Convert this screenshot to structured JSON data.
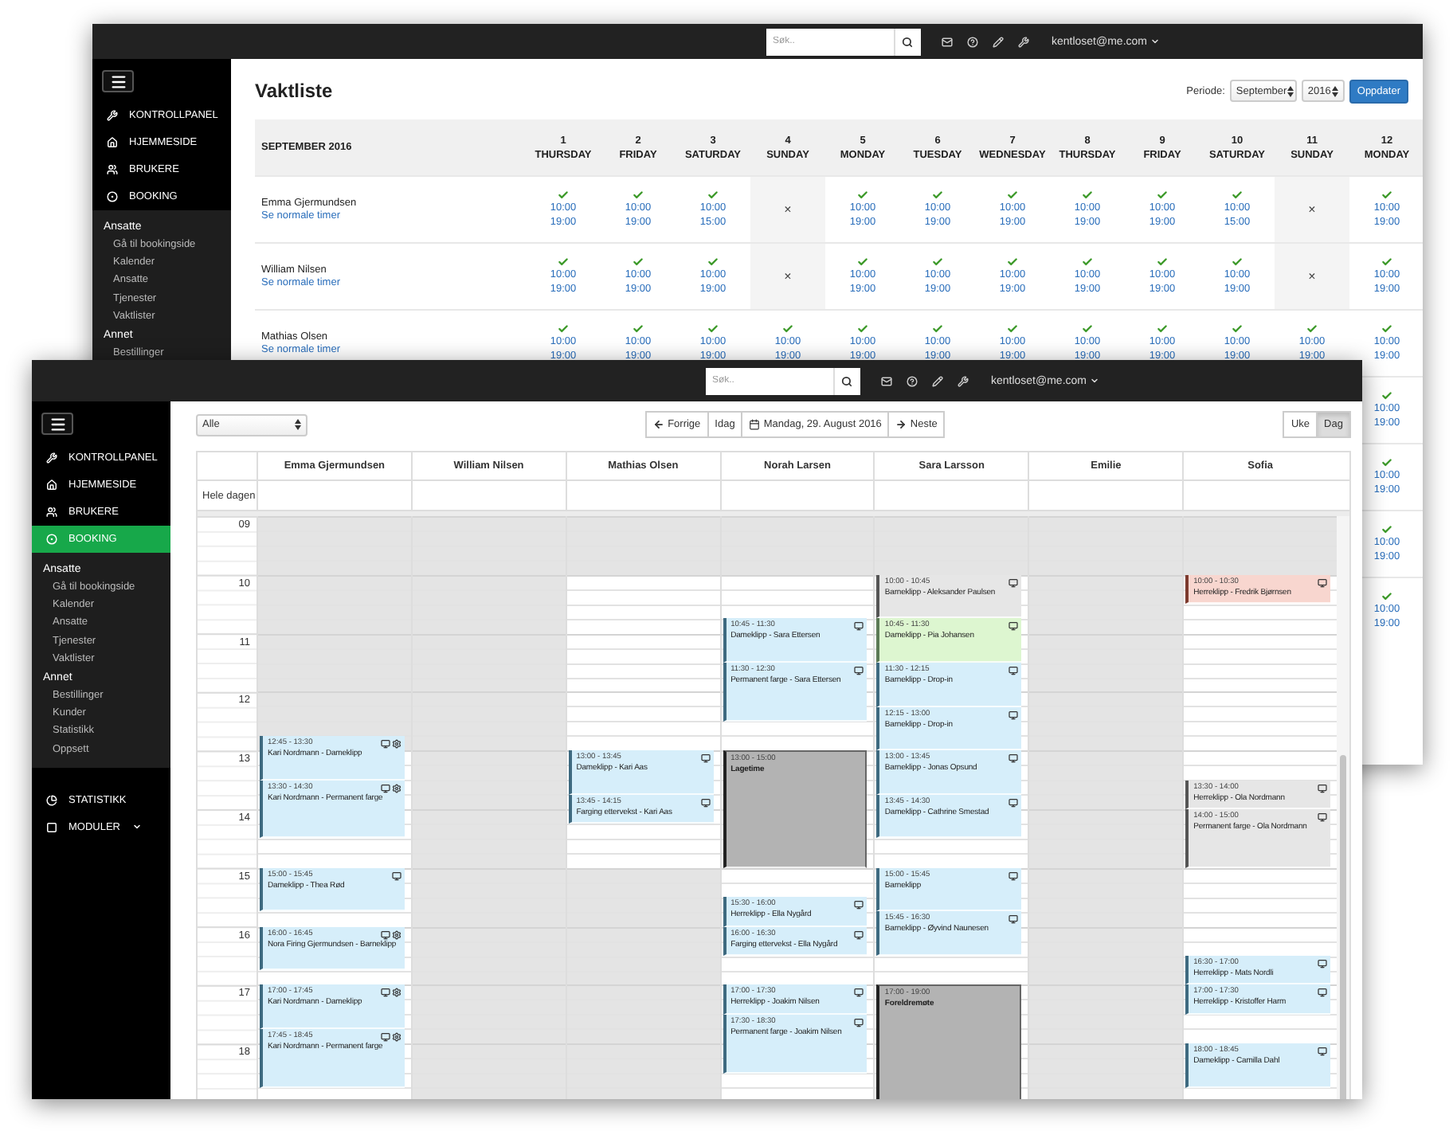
{
  "back_window": {
    "topbar": {
      "search": {
        "placeholder": "Søk.."
      },
      "user": "kentloset@me.com"
    },
    "sidebar": {
      "main_items": [
        {
          "label": "KONTROLLPANEL",
          "selected": false
        },
        {
          "label": "HJEMMESIDE",
          "selected": false
        },
        {
          "label": "BRUKERE",
          "selected": false
        },
        {
          "label": "BOOKING",
          "selected": false
        }
      ],
      "sections": [
        {
          "title": "Ansatte",
          "items": [
            "Gå til bookingside",
            "Kalender",
            "Ansatte",
            "Tjenester",
            "Vaktlister"
          ]
        },
        {
          "title": "Annet",
          "items": [
            "Bestillinger"
          ]
        }
      ]
    },
    "title": "Vaktliste",
    "period": {
      "label": "Periode:",
      "month": "September",
      "year": "2016",
      "button": "Oppdater"
    },
    "table": {
      "heading": "SEPTEMBER 2016",
      "days": [
        {
          "date": "1",
          "weekday": "THURSDAY"
        },
        {
          "date": "2",
          "weekday": "FRIDAY"
        },
        {
          "date": "3",
          "weekday": "SATURDAY"
        },
        {
          "date": "4",
          "weekday": "SUNDAY"
        },
        {
          "date": "5",
          "weekday": "MONDAY"
        },
        {
          "date": "6",
          "weekday": "TUESDAY"
        },
        {
          "date": "7",
          "weekday": "WEDNESDAY"
        },
        {
          "date": "8",
          "weekday": "THURSDAY"
        },
        {
          "date": "9",
          "weekday": "FRIDAY"
        },
        {
          "date": "10",
          "weekday": "SATURDAY"
        },
        {
          "date": "11",
          "weekday": "SUNDAY"
        },
        {
          "date": "12",
          "weekday": "MONDAY"
        }
      ],
      "rows": [
        {
          "name": "Emma Gjermundsen",
          "link": "Se normale timer",
          "cells": [
            {
              "kind": "shift",
              "start": "10:00",
              "end": "19:00"
            },
            {
              "kind": "shift",
              "start": "10:00",
              "end": "19:00"
            },
            {
              "kind": "shift",
              "start": "10:00",
              "end": "15:00"
            },
            {
              "kind": "off",
              "mark": "×"
            },
            {
              "kind": "shift",
              "start": "10:00",
              "end": "19:00"
            },
            {
              "kind": "shift",
              "start": "10:00",
              "end": "19:00"
            },
            {
              "kind": "shift",
              "start": "10:00",
              "end": "19:00"
            },
            {
              "kind": "shift",
              "start": "10:00",
              "end": "19:00"
            },
            {
              "kind": "shift",
              "start": "10:00",
              "end": "19:00"
            },
            {
              "kind": "shift",
              "start": "10:00",
              "end": "15:00"
            },
            {
              "kind": "off",
              "mark": "×"
            },
            {
              "kind": "shift",
              "start": "10:00",
              "end": "19:00"
            }
          ]
        },
        {
          "name": "William Nilsen",
          "link": "Se normale timer",
          "cells": [
            {
              "kind": "shift",
              "start": "10:00",
              "end": "19:00"
            },
            {
              "kind": "shift",
              "start": "10:00",
              "end": "19:00"
            },
            {
              "kind": "shift",
              "start": "10:00",
              "end": "19:00"
            },
            {
              "kind": "off",
              "mark": "×"
            },
            {
              "kind": "shift",
              "start": "10:00",
              "end": "19:00"
            },
            {
              "kind": "shift",
              "start": "10:00",
              "end": "19:00"
            },
            {
              "kind": "shift",
              "start": "10:00",
              "end": "19:00"
            },
            {
              "kind": "shift",
              "start": "10:00",
              "end": "19:00"
            },
            {
              "kind": "shift",
              "start": "10:00",
              "end": "19:00"
            },
            {
              "kind": "shift",
              "start": "10:00",
              "end": "19:00"
            },
            {
              "kind": "off",
              "mark": "×"
            },
            {
              "kind": "shift",
              "start": "10:00",
              "end": "19:00"
            }
          ]
        },
        {
          "name": "Mathias Olsen",
          "link": "Se normale timer",
          "cells": [
            {
              "kind": "shift",
              "start": "10:00",
              "end": "19:00"
            },
            {
              "kind": "shift",
              "start": "10:00",
              "end": "19:00"
            },
            {
              "kind": "shift",
              "start": "10:00",
              "end": "19:00"
            },
            {
              "kind": "shift",
              "start": "10:00",
              "end": "19:00"
            },
            {
              "kind": "shift",
              "start": "10:00",
              "end": "19:00"
            },
            {
              "kind": "shift",
              "start": "10:00",
              "end": "19:00"
            },
            {
              "kind": "shift",
              "start": "10:00",
              "end": "19:00"
            },
            {
              "kind": "shift",
              "start": "10:00",
              "end": "19:00"
            },
            {
              "kind": "shift",
              "start": "10:00",
              "end": "19:00"
            },
            {
              "kind": "shift",
              "start": "10:00",
              "end": "19:00"
            },
            {
              "kind": "shift",
              "start": "10:00",
              "end": "19:00"
            },
            {
              "kind": "shift",
              "start": "10:00",
              "end": "19:00"
            }
          ]
        }
      ],
      "more_rows": [
        {
          "last_cell": {
            "kind": "shift",
            "start": "10:00",
            "end": "19:00"
          }
        },
        {
          "last_cell": {
            "kind": "shift",
            "start": "10:00",
            "end": "19:00"
          }
        },
        {
          "last_cell": {
            "kind": "shift",
            "start": "10:00",
            "end": "19:00"
          }
        },
        {
          "last_cell": {
            "kind": "shift",
            "start": "10:00",
            "end": "19:00"
          }
        }
      ]
    }
  },
  "front_window": {
    "topbar": {
      "search": {
        "placeholder": "Søk.."
      },
      "user": "kentloset@me.com"
    },
    "sidebar": {
      "main_items": [
        {
          "label": "KONTROLLPANEL",
          "selected": false
        },
        {
          "label": "HJEMMESIDE",
          "selected": false
        },
        {
          "label": "BRUKERE",
          "selected": false
        },
        {
          "label": "BOOKING",
          "selected": true
        }
      ],
      "sections": [
        {
          "title": "Ansatte",
          "items": [
            "Gå til bookingside",
            "Kalender",
            "Ansatte",
            "Tjenester",
            "Vaktlister"
          ]
        },
        {
          "title": "Annet",
          "items": [
            "Bestillinger",
            "Kunder",
            "Statistikk",
            "Oppsett"
          ]
        }
      ],
      "bottom_items": [
        {
          "label": "STATISTIKK",
          "dropdown": false
        },
        {
          "label": "MODULER",
          "dropdown": true
        }
      ]
    },
    "filter": {
      "value": "Alle"
    },
    "nav": {
      "previous": "Forrige",
      "today": "Idag",
      "date": "Mandag, 29. August 2016",
      "next": "Neste"
    },
    "views": [
      {
        "label": "Uke",
        "selected": false
      },
      {
        "label": "Dag",
        "selected": true
      }
    ],
    "calendar": {
      "all_day_label": "Hele dagen",
      "hours": [
        "09",
        "10",
        "11",
        "12",
        "13",
        "14",
        "15",
        "16",
        "17",
        "18"
      ],
      "resources": [
        {
          "name": "Emma Gjermundsen",
          "open": [
            false,
            false,
            false,
            false,
            true,
            true,
            true,
            true,
            true,
            true
          ],
          "events": [
            {
              "time": "12:45 - 13:30",
              "title": "Kari Nordmann - Dameklipp",
              "kind": "booked",
              "screen": true,
              "gear": true
            },
            {
              "time": "13:30 - 14:30",
              "title": "Kari Nordmann - Permanent farge",
              "kind": "booked",
              "screen": true,
              "gear": true
            },
            {
              "time": "15:00 - 15:45",
              "title": "Dameklipp - Thea Rød",
              "kind": "booked",
              "screen": true,
              "gear": false
            },
            {
              "time": "16:00 - 16:45",
              "title": "Nora Firing Gjermundsen - Barneklipp",
              "kind": "booked",
              "screen": true,
              "gear": true
            },
            {
              "time": "17:00 - 17:45",
              "title": "Kari Nordmann - Dameklipp",
              "kind": "booked",
              "screen": true,
              "gear": true
            },
            {
              "time": "17:45 - 18:45",
              "title": "Kari Nordmann - Permanent farge",
              "kind": "booked",
              "screen": true,
              "gear": true
            }
          ]
        },
        {
          "name": "William Nilsen",
          "open": [
            false,
            false,
            false,
            false,
            false,
            false,
            false,
            false,
            false,
            false
          ]
        },
        {
          "name": "Mathias Olsen",
          "open": [
            false,
            true,
            true,
            true,
            true,
            true,
            false,
            false,
            false,
            false
          ],
          "events": [
            {
              "time": "13:00 - 13:45",
              "title": "Dameklipp - Kari Aas",
              "kind": "booked",
              "screen": true,
              "gear": false
            },
            {
              "time": "13:45 - 14:15",
              "title": "Farging ettervekst - Kari Aas",
              "kind": "booked",
              "screen": true,
              "gear": false
            }
          ]
        },
        {
          "name": "Norah Larsen",
          "open": [
            false,
            true,
            true,
            true,
            true,
            true,
            true,
            true,
            true,
            true
          ],
          "events": [
            {
              "time": "10:45 - 11:30",
              "title": "Dameklipp - Sara Ettersen",
              "kind": "booked",
              "screen": true,
              "gear": false
            },
            {
              "time": "11:30 - 12:30",
              "title": "Permanent farge - Sara Ettersen",
              "kind": "booked",
              "screen": true,
              "gear": false
            },
            {
              "time": "13:00 - 15:00",
              "title": "Lagetime",
              "kind": "block",
              "screen": false,
              "gear": false
            },
            {
              "time": "15:30 - 16:00",
              "title": "Herreklipp - Ella Nygård",
              "kind": "booked",
              "screen": true,
              "gear": false
            },
            {
              "time": "16:00 - 16:30",
              "title": "Farging ettervekst - Ella Nygård",
              "kind": "booked",
              "screen": true,
              "gear": false
            },
            {
              "time": "17:00 - 17:30",
              "title": "Herreklipp - Joakim Nilsen",
              "kind": "booked",
              "screen": true,
              "gear": false
            },
            {
              "time": "17:30 - 18:30",
              "title": "Permanent farge - Joakim Nilsen",
              "kind": "booked",
              "screen": true,
              "gear": false
            }
          ]
        },
        {
          "name": "Sara Larsson",
          "open": [
            false,
            true,
            true,
            true,
            true,
            true,
            true,
            true,
            true,
            true
          ],
          "events": [
            {
              "time": "10:00 - 10:45",
              "title": "Barneklipp - Aleksander Paulsen",
              "kind": "pending",
              "screen": true,
              "gear": false
            },
            {
              "time": "10:45 - 11:30",
              "title": "Dameklipp - Pia Johansen",
              "kind": "confirmed",
              "screen": true,
              "gear": false
            },
            {
              "time": "11:30 - 12:15",
              "title": "Barneklipp - Drop-in",
              "kind": "booked",
              "screen": true,
              "gear": false
            },
            {
              "time": "12:15 - 13:00",
              "title": "Barneklipp - Drop-in",
              "kind": "booked",
              "screen": true,
              "gear": false
            },
            {
              "time": "13:00 - 13:45",
              "title": "Barneklipp - Jonas Opsund",
              "kind": "booked",
              "screen": true,
              "gear": false
            },
            {
              "time": "13:45 - 14:30",
              "title": "Dameklipp - Cathrine Smestad",
              "kind": "booked",
              "screen": true,
              "gear": false
            },
            {
              "time": "15:00 - 15:45",
              "title": "Barneklipp",
              "kind": "booked",
              "screen": true,
              "gear": false
            },
            {
              "time": "15:45 - 16:30",
              "title": "Barneklipp - Øyvind Naunesen",
              "kind": "booked",
              "screen": true,
              "gear": false
            },
            {
              "time": "17:00 - 19:00",
              "title": "Foreldremøte",
              "kind": "block",
              "screen": false,
              "gear": false
            }
          ]
        },
        {
          "name": "Emilie",
          "open": [
            false,
            false,
            false,
            false,
            false,
            false,
            false,
            false,
            false,
            false
          ]
        },
        {
          "name": "Sofia",
          "open": [
            false,
            true,
            true,
            true,
            true,
            true,
            true,
            true,
            true,
            true
          ],
          "events": [
            {
              "time": "10:00 - 10:30",
              "title": "Herreklipp - Fredrik Bjørnsen",
              "kind": "cancelled",
              "screen": true,
              "gear": false
            },
            {
              "time": "13:30 - 14:00",
              "title": "Herreklipp - Ola Nordmann",
              "kind": "pending",
              "screen": true,
              "gear": false
            },
            {
              "time": "14:00 - 15:00",
              "title": "Permanent farge - Ola Nordmann",
              "kind": "pending",
              "screen": true,
              "gear": false
            },
            {
              "time": "16:30 - 17:00",
              "title": "Herreklipp - Mats Nordli",
              "kind": "booked",
              "screen": true,
              "gear": false
            },
            {
              "time": "17:00 - 17:30",
              "title": "Herreklipp - Kristoffer Harm",
              "kind": "booked",
              "screen": true,
              "gear": false
            },
            {
              "time": "18:00 - 18:45",
              "title": "Dameklipp - Camilla Dahl",
              "kind": "booked",
              "screen": true,
              "gear": false
            }
          ]
        }
      ]
    }
  }
}
